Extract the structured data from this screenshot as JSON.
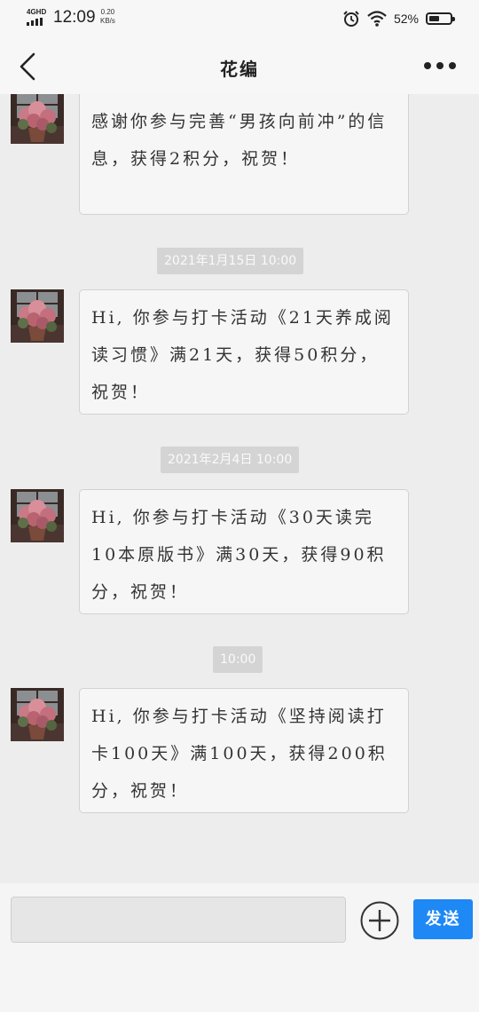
{
  "status": {
    "network": "4GHD",
    "time": "12:09",
    "speed_value": "0.20",
    "speed_unit": "KB/s",
    "battery": "52%",
    "battery_level": 0.52
  },
  "nav": {
    "title": "花编"
  },
  "messages": [
    {
      "text": "感谢你参与完善“男孩向前冲”的信息，获得2积分，祝贺！"
    },
    {
      "timestamp": "2021年1月15日 10:00",
      "text": "Hi, 你参与打卡活动《21天养成阅读习惯》满21天，获得50积分，祝贺！"
    },
    {
      "timestamp": "2021年2月4日 10:00",
      "text": "Hi, 你参与打卡活动《30天读完10本原版书》满30天，获得90积分，祝贺！"
    },
    {
      "timestamp": "10:00",
      "text": "Hi, 你参与打卡活动《坚持阅读打卡100天》满100天，获得200积分，祝贺！"
    }
  ],
  "input": {
    "placeholder": "",
    "send_label": "发送"
  },
  "icons": {
    "back": "chevron-left-icon",
    "more": "more-icon",
    "plus": "plus-icon",
    "alarm": "alarm-icon",
    "wifi": "wifi-icon",
    "battery": "battery-icon",
    "signal": "signal-icon"
  },
  "colors": {
    "accent": "#1e88f5",
    "background": "#ededed",
    "bubble": "#f6f6f6"
  }
}
